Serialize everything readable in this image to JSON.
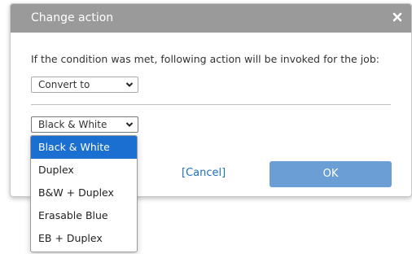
{
  "dialog": {
    "title": "Change action",
    "prompt": "If the condition was met, following action will be invoked for the job:",
    "action_select": {
      "value": "Convert to"
    },
    "mode_select": {
      "value": "Black & White"
    },
    "cancel_label": "[Cancel]",
    "ok_label": "OK"
  },
  "dropdown": {
    "options": [
      {
        "label": "Black & White",
        "selected": true
      },
      {
        "label": "Duplex"
      },
      {
        "label": "B&W + Duplex"
      },
      {
        "label": "Erasable Blue"
      },
      {
        "label": "EB + Duplex"
      }
    ]
  },
  "colors": {
    "titlebar": "#9a9a9a",
    "ok_button": "#6a9ed4",
    "selected_option": "#1a6fd1",
    "link": "#1e6fbf"
  },
  "icons": [
    "close-icon",
    "chevron-down-icon"
  ]
}
